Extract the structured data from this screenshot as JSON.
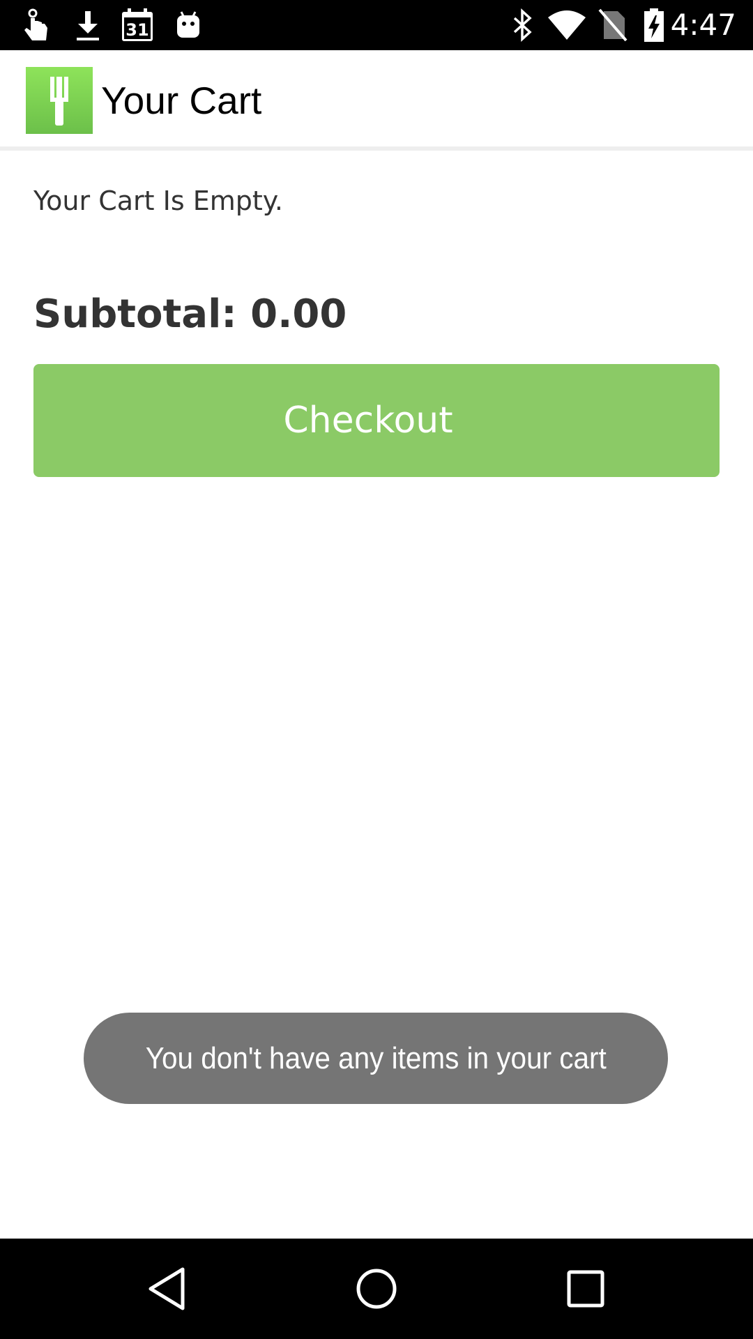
{
  "status_bar": {
    "time": "4:47",
    "calendar_day": "31",
    "left_icons": [
      "hand-notification-icon",
      "download-icon",
      "calendar-icon",
      "android-icon"
    ],
    "right_icons": [
      "bluetooth-icon",
      "wifi-icon",
      "no-sim-icon",
      "battery-charging-icon"
    ]
  },
  "toolbar": {
    "title": "Your Cart",
    "logo_icon": "fork-icon",
    "logo_color": "#7cd352"
  },
  "cart": {
    "empty_message": "Your Cart Is Empty.",
    "subtotal_label": "Subtotal: 0.00",
    "checkout_label": "Checkout",
    "checkout_color": "#8bca66"
  },
  "toast": {
    "message": "You don't have any items in your cart"
  },
  "nav_bar": {
    "buttons": [
      "back-icon",
      "home-icon",
      "recents-icon"
    ]
  }
}
